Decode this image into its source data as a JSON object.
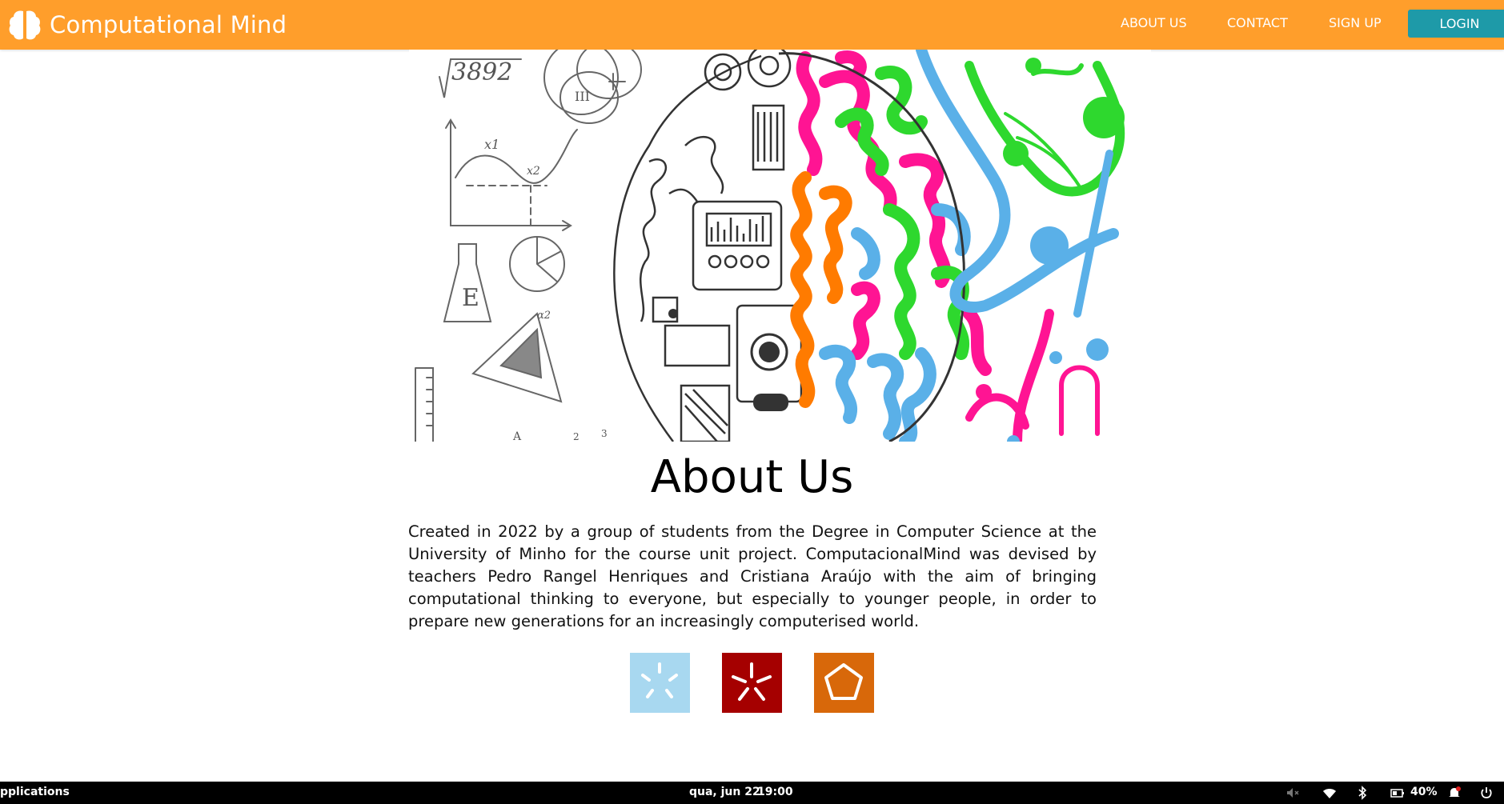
{
  "navbar": {
    "brand_text": "Computational Mind",
    "brand_icon": "brain-icon",
    "links": [
      "ABOUT US",
      "CONTACT",
      "SIGN UP"
    ],
    "login_label": "LOGIN",
    "background_color": "#ff9e2b",
    "login_color": "#1e9aa8"
  },
  "hero": {
    "left_text_1": "3892",
    "left_text_2": "III",
    "left_text_3": "x1",
    "left_text_4": "x2",
    "left_text_5": "E",
    "left_text_6": "α2",
    "left_text_7": "A",
    "left_text_8": "2",
    "left_text_9": "3"
  },
  "about": {
    "title": "About Us",
    "text": "Created in 2022 by a group of students from the Degree in Computer Science at the University of Minho for the course unit project. ComputacionalMind was devised by teachers Pedro Rangel Henriques and Cristiana Araújo with the aim of bringing computational thinking to everyone, but especially to younger people, in order to prepare new generations for an increasingly computerised world.",
    "logos": [
      {
        "name": "university-logo-light-blue",
        "color": "#a8d8f0"
      },
      {
        "name": "university-of-minho-logo",
        "color": "#a50000"
      },
      {
        "name": "engineering-school-logo",
        "color": "#d8680a"
      }
    ]
  },
  "taskbar": {
    "apps_label": "pplications",
    "date": "qua, jun 22",
    "time": "19:00",
    "battery": "40%",
    "icons": [
      "volume-muted-icon",
      "wifi-icon",
      "bluetooth-icon",
      "battery-icon",
      "notification-icon",
      "power-icon"
    ]
  }
}
